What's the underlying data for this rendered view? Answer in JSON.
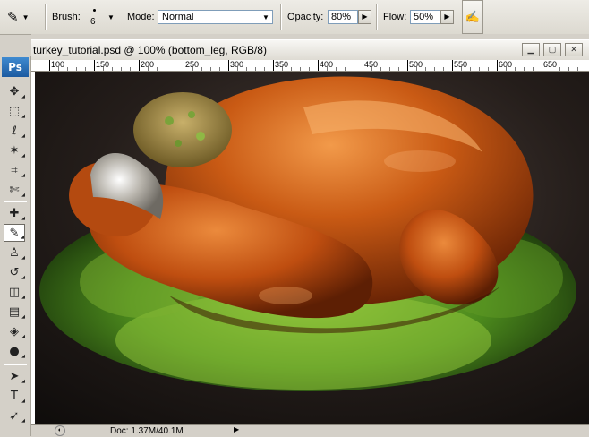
{
  "options_bar": {
    "brush_label": "Brush:",
    "brush_size": "6",
    "mode_label": "Mode:",
    "mode_value": "Normal",
    "opacity_label": "Opacity:",
    "opacity_value": "80%",
    "flow_label": "Flow:",
    "flow_value": "50%"
  },
  "toolbox": {
    "logo": "Ps",
    "tools": [
      {
        "name": "move-tool",
        "glyph": "✥"
      },
      {
        "name": "marquee-tool",
        "glyph": "⬚"
      },
      {
        "name": "lasso-tool",
        "glyph": "ℓ"
      },
      {
        "name": "magic-wand-tool",
        "glyph": "✶"
      },
      {
        "name": "crop-tool",
        "glyph": "⌗"
      },
      {
        "name": "slice-tool",
        "glyph": "✄"
      },
      {
        "name": "healing-brush-tool",
        "glyph": "✚"
      },
      {
        "name": "brush-tool",
        "glyph": "✎"
      },
      {
        "name": "clone-stamp-tool",
        "glyph": "♙"
      },
      {
        "name": "history-brush-tool",
        "glyph": "↺"
      },
      {
        "name": "eraser-tool",
        "glyph": "◫"
      },
      {
        "name": "gradient-tool",
        "glyph": "▤"
      },
      {
        "name": "blur-tool",
        "glyph": "◈"
      },
      {
        "name": "dodge-tool",
        "glyph": "●"
      },
      {
        "name": "path-selection-tool",
        "glyph": "➤"
      },
      {
        "name": "type-tool",
        "glyph": "T"
      },
      {
        "name": "direct-selection-tool",
        "glyph": "➹"
      }
    ],
    "active_tool": "brush-tool"
  },
  "document": {
    "title": "turkey_tutorial.psd @ 100% (bottom_leg, RGB/8)",
    "ruler_labels": [
      "100",
      "150",
      "200",
      "250",
      "300",
      "350",
      "400",
      "450",
      "500",
      "550",
      "600",
      "650"
    ],
    "status_doc": "Doc: 1.37M/40.1M"
  },
  "colors": {
    "background_dark": "#1a1614",
    "turkey_skin": "#c8520f",
    "lettuce": "#4e8a1c",
    "stuffing": "#8f7a3b"
  }
}
